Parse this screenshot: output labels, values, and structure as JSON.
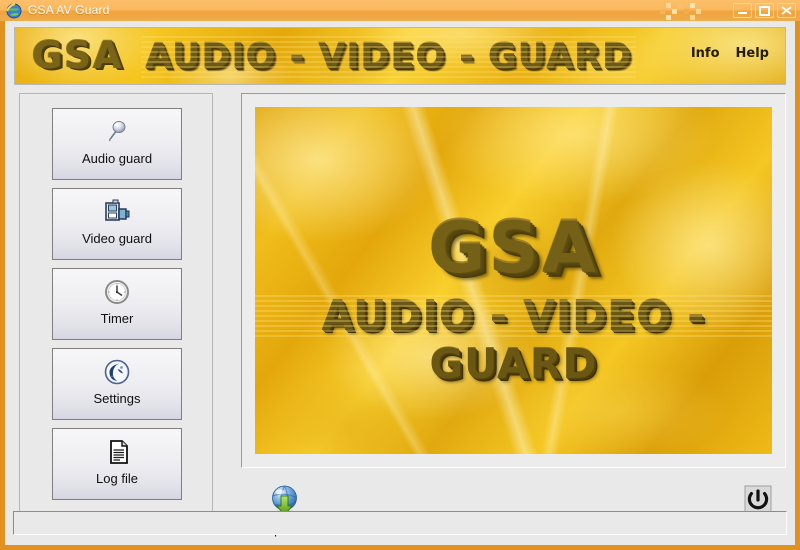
{
  "window": {
    "title": "GSA AV Guard",
    "icon": "globe-shield-icon",
    "frame_color": "#e1911f",
    "titlebar_color": "#fbb95f",
    "caption_buttons": {
      "minimize": "Minimize",
      "maximize": "Maximize",
      "close": "Close"
    }
  },
  "banner": {
    "logo_main": "GSA",
    "logo_sub": "AUDIO - VIDEO - GUARD",
    "links": [
      {
        "label": "Info",
        "name": "info-link"
      },
      {
        "label": "Help",
        "name": "help-link"
      }
    ]
  },
  "sidebar": {
    "items": [
      {
        "label": "Audio guard",
        "icon": "microphone-icon"
      },
      {
        "label": "Video guard",
        "icon": "camcorder-icon"
      },
      {
        "label": "Timer",
        "icon": "clock-icon"
      },
      {
        "label": "Settings",
        "icon": "settings-tool-icon"
      },
      {
        "label": "Log file",
        "icon": "document-icon"
      }
    ]
  },
  "viewer": {
    "splash_main": "GSA",
    "splash_sub": "AUDIO - VIDEO - GUARD",
    "background": "gold-plasma-clouds"
  },
  "toolbar": {
    "update": {
      "label": "Update",
      "icon": "globe-download-icon"
    },
    "close": {
      "label": "Close",
      "icon": "power-icon"
    }
  },
  "statusbar": {
    "text": ""
  }
}
